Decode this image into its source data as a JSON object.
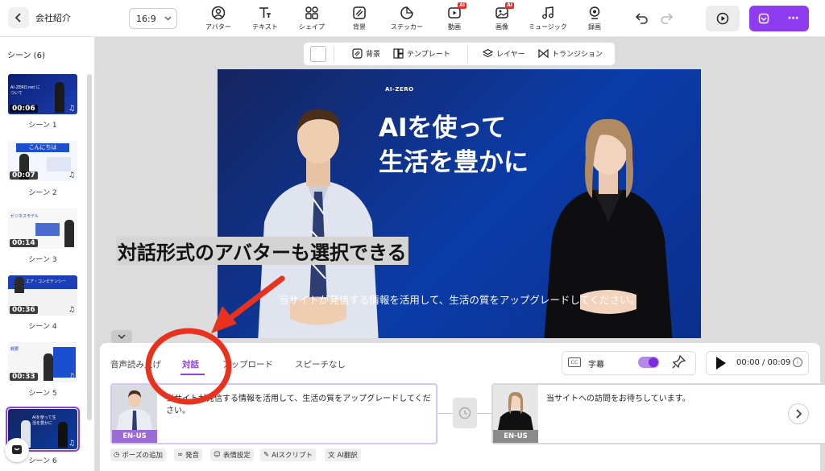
{
  "header": {
    "back_icon": "chevron-left-icon",
    "project_title": "会社紹介",
    "aspect_ratio": "16:9",
    "tools": [
      {
        "label": "アバター",
        "icon": "avatar-icon"
      },
      {
        "label": "テキスト",
        "icon": "text-icon"
      },
      {
        "label": "シェイプ",
        "icon": "shape-icon"
      },
      {
        "label": "背景",
        "icon": "background-icon"
      },
      {
        "label": "ステッカー",
        "icon": "sticker-icon"
      },
      {
        "label": "動画",
        "icon": "video-icon",
        "badge": "AI"
      },
      {
        "label": "画像",
        "icon": "image-icon",
        "badge": "AI"
      },
      {
        "label": "ミュージック",
        "icon": "music-icon"
      },
      {
        "label": "録画",
        "icon": "record-icon"
      }
    ]
  },
  "scenes": {
    "heading": "シーン (6)",
    "items": [
      {
        "label": "シーン 1",
        "duration": "00:06",
        "thumb_text": "AI-ZERO.net について"
      },
      {
        "label": "シーン 2",
        "duration": "00:07",
        "thumb_text": "こんにちは"
      },
      {
        "label": "シーン 3",
        "duration": "00:14",
        "thumb_text": "ビジネスモデル"
      },
      {
        "label": "シーン 4",
        "duration": "00:36",
        "thumb_text": "エア・コンピテンシー"
      },
      {
        "label": "シーン 5",
        "duration": "00:33",
        "thumb_text": "概要"
      },
      {
        "label": "シーン 6",
        "duration": "",
        "thumb_text": "AIを使って生活を豊かに"
      }
    ]
  },
  "canvas_toolbar": {
    "background": "背景",
    "template": "テンプレート",
    "layer": "レイヤー",
    "transition": "トランジション"
  },
  "stage": {
    "logo": "AI-ZERO",
    "heading_line1": "AIを使って",
    "heading_line2": "生活を豊かに",
    "caption": "当サイトが発信する情報を活用して、生活の質をアップグレードしてください。"
  },
  "annotation": "対話形式のアバターも選択できる",
  "bottom": {
    "tabs": [
      "音声読み上げ",
      "対話",
      "アップロード",
      "スピーチなし"
    ],
    "active_tab": "対話",
    "subtitle_label": "字幕",
    "subtitle_on": true,
    "cc_text": "CC",
    "time": "00:00 / 00:09",
    "speakers": [
      {
        "lang": "EN-US",
        "text": "当サイトが発信する情報を活用して、生活の質をアップグレードしてください。",
        "lang_color": "#9b6bd6"
      },
      {
        "lang": "EN-US",
        "text": "当サイトへの訪問をお待ちしています。",
        "lang_color": "#8a8a8a"
      }
    ],
    "actions": [
      "ポーズの追加",
      "発音",
      "表情設定",
      "AIスクリプト",
      "AI翻訳"
    ]
  },
  "colors": {
    "accent": "#8f3cf0",
    "annotation_red": "#e8321e"
  }
}
